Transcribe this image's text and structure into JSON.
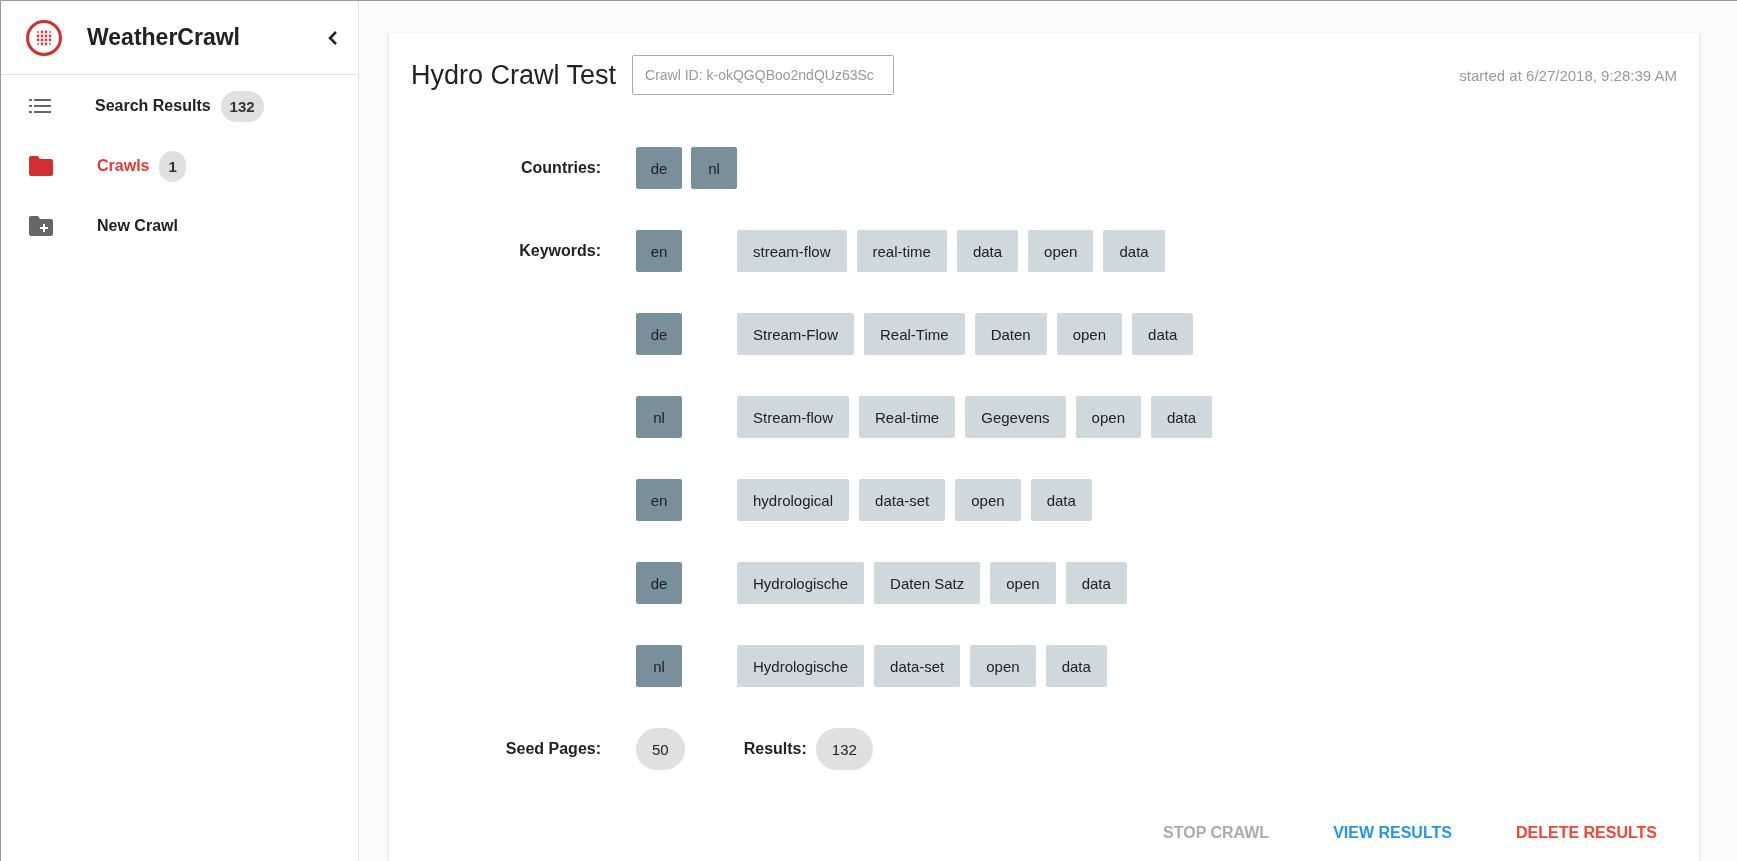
{
  "sidebar": {
    "title": "WeatherCrawl",
    "items": [
      {
        "label": "Search Results",
        "count": "132",
        "kind": "list",
        "selected": false
      },
      {
        "label": "Crawls",
        "count": "1",
        "kind": "folder",
        "selected": true
      },
      {
        "label": "New Crawl",
        "kind": "folder-add",
        "selected": false
      }
    ]
  },
  "crawl": {
    "title": "Hydro Crawl Test",
    "id_field": {
      "placeholder": "Crawl ID: k-okQGQBoo2ndQUz63Sc"
    },
    "started": "started at 6/27/2018, 9:28:39 AM",
    "countries_label": "Countries:",
    "countries": [
      "de",
      "nl"
    ],
    "keywords_label": "Keywords:",
    "keywords": [
      {
        "language": "en",
        "terms": [
          "stream-flow",
          "real-time",
          "data",
          "open",
          "data"
        ]
      },
      {
        "language": "de",
        "terms": [
          "Stream-Flow",
          "Real-Time",
          "Daten",
          "open",
          "data"
        ]
      },
      {
        "language": "nl",
        "terms": [
          "Stream-flow",
          "Real-time",
          "Gegevens",
          "open",
          "data"
        ]
      },
      {
        "language": "en",
        "terms": [
          "hydrological",
          "data-set",
          "open",
          "data"
        ]
      },
      {
        "language": "de",
        "terms": [
          "Hydrologische",
          "Daten Satz",
          "open",
          "data"
        ]
      },
      {
        "language": "nl",
        "terms": [
          "Hydrologische",
          "data-set",
          "open",
          "data"
        ]
      }
    ],
    "seed_label": "Seed Pages:",
    "seed_count": "50",
    "results_label": "Results:",
    "results_count": "132",
    "actions": [
      {
        "label": "STOP CRAWL",
        "kind": "neutral",
        "disabled": true
      },
      {
        "label": "VIEW RESULTS",
        "kind": "primary",
        "disabled": false
      },
      {
        "label": "DELETE RESULTS",
        "kind": "danger",
        "disabled": false
      }
    ]
  }
}
